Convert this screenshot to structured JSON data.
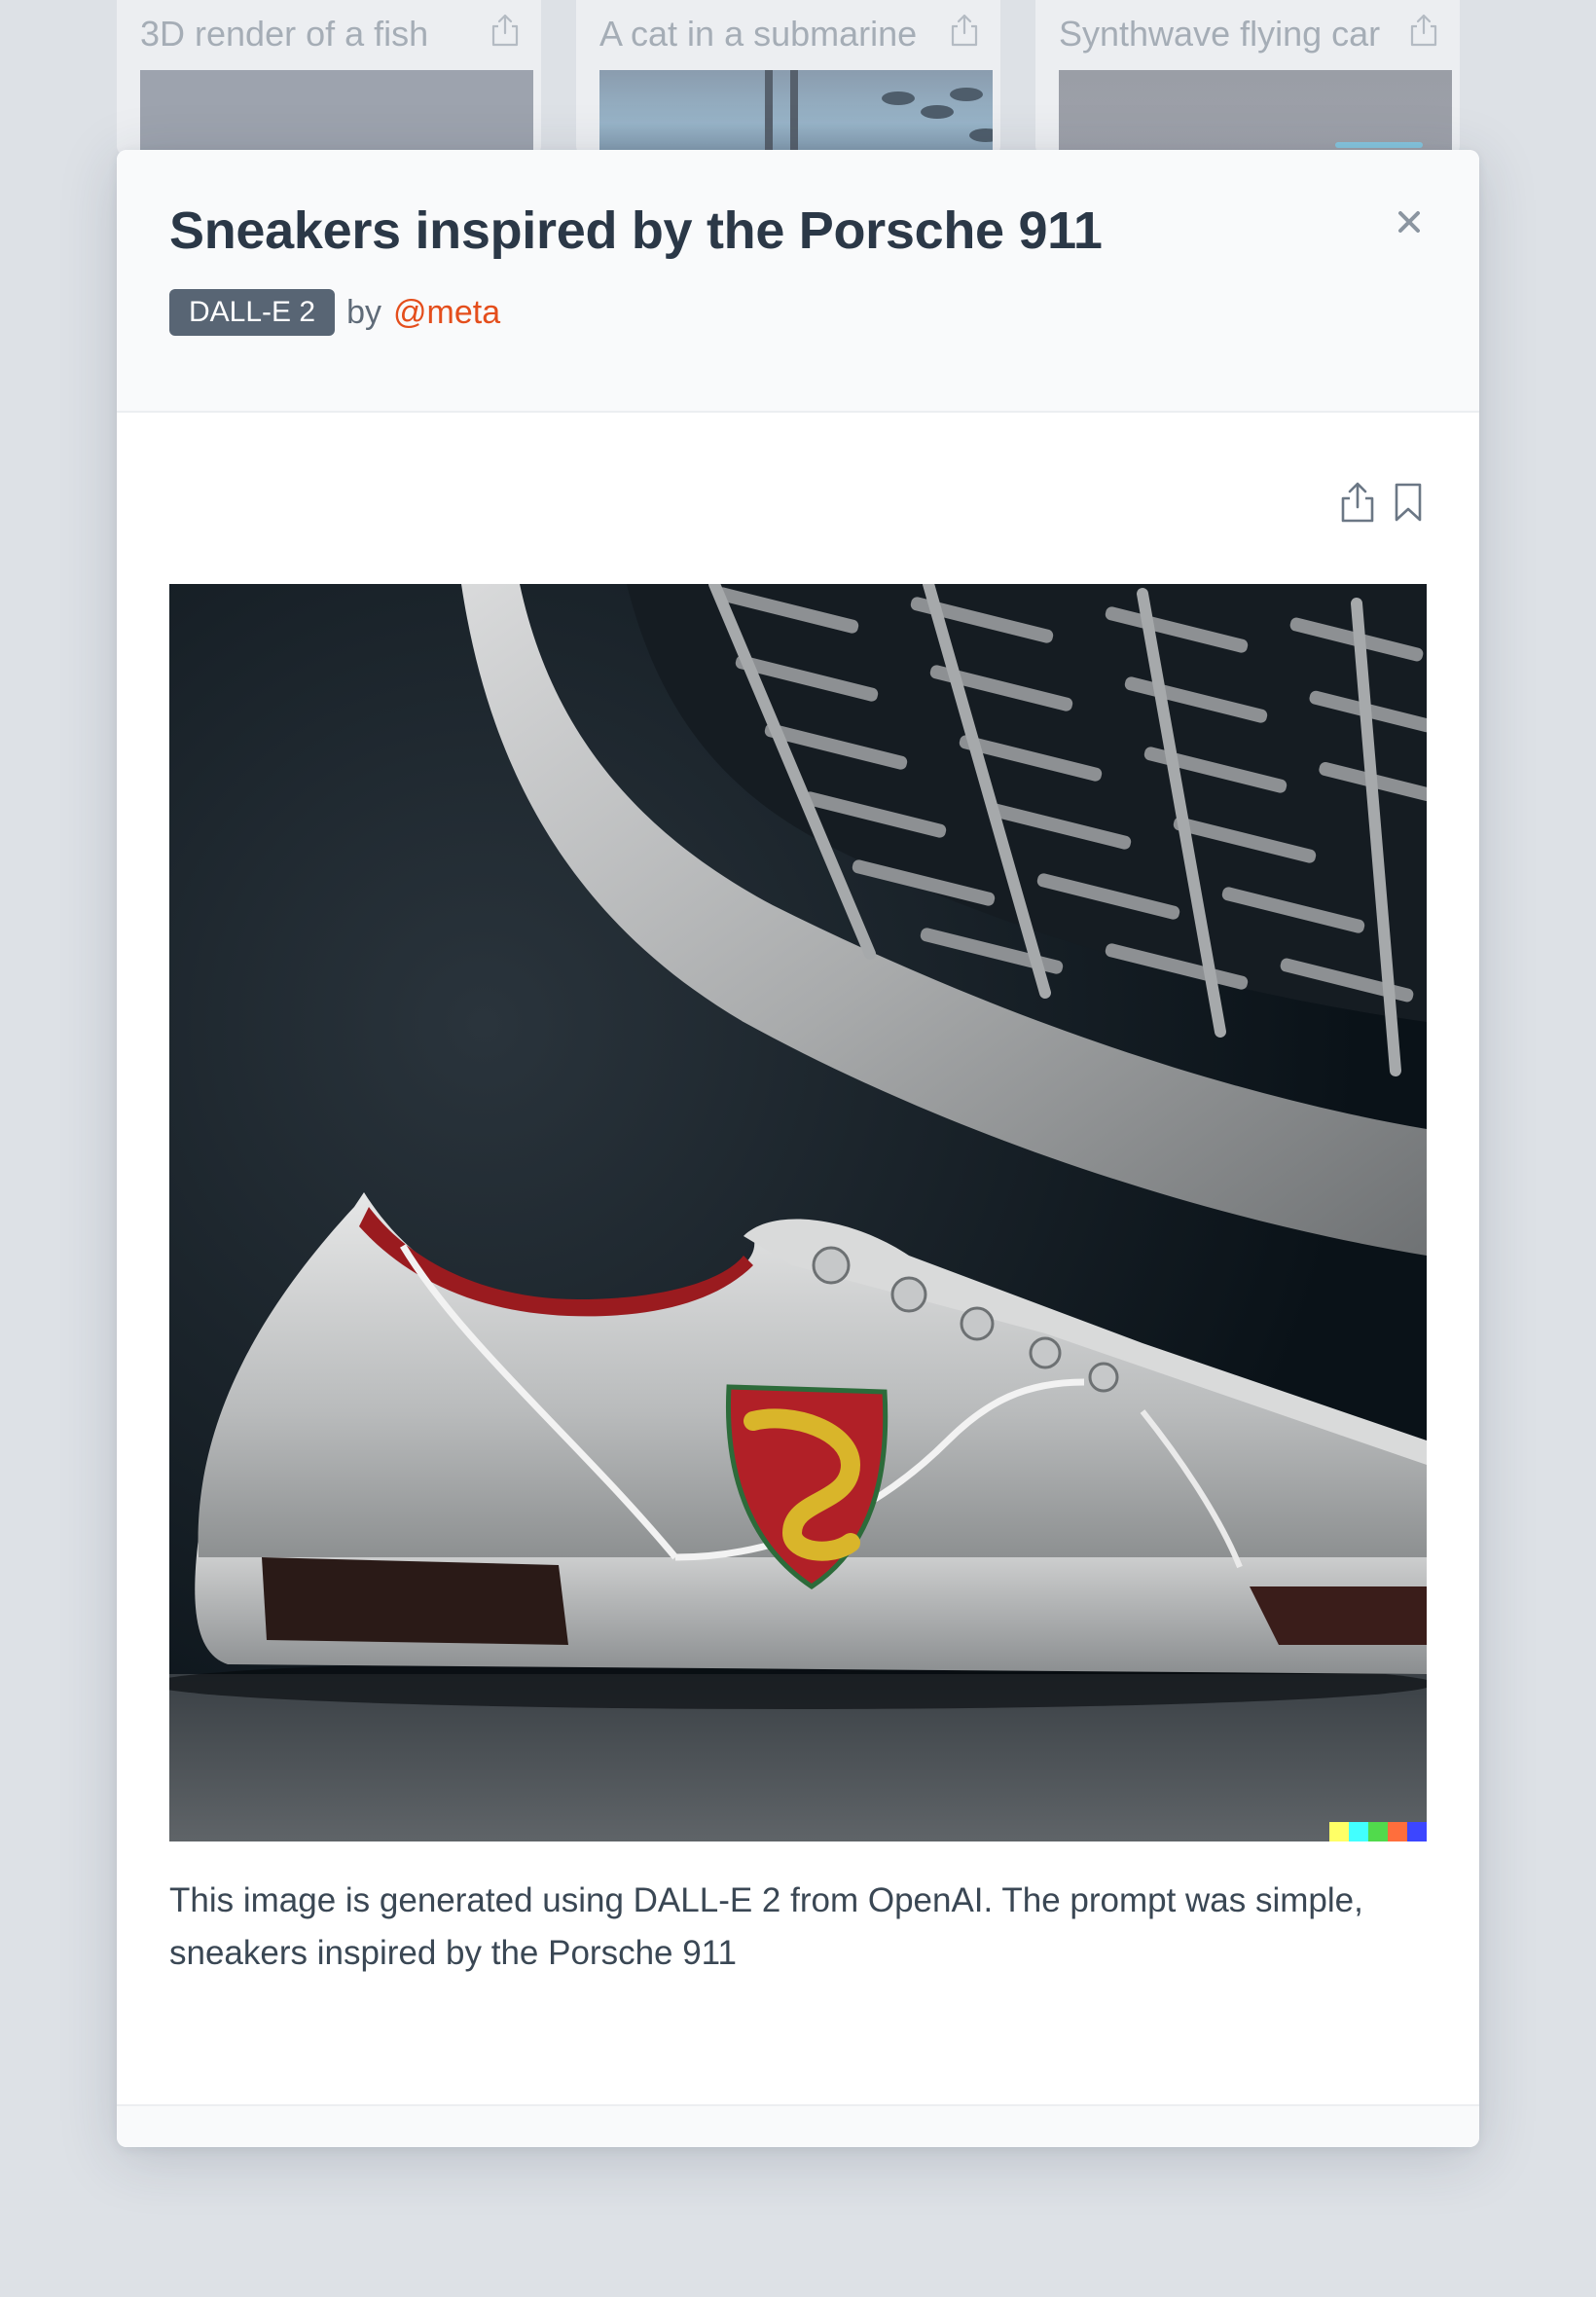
{
  "gallery": {
    "cards": [
      {
        "title": "3D render of a fish",
        "share_icon": "share-icon"
      },
      {
        "title": "A cat in a submarine",
        "share_icon": "share-icon"
      },
      {
        "title": "Synthwave flying car",
        "share_icon": "share-icon"
      }
    ]
  },
  "modal": {
    "title": "Sneakers inspired by the Porsche 911",
    "model_badge": "DALL-E 2",
    "by_label": "by",
    "author": "@meta",
    "close_icon": "close-icon",
    "actions": {
      "share_icon": "share-icon",
      "bookmark_icon": "bookmark-icon"
    },
    "image": {
      "subject": "Silver sneaker with red lining and crest emblem in front of a car grille"
    },
    "description": "This image is generated using DALL-E 2 from OpenAI. The prompt was simple, sneakers inspired by the Porsche 911"
  },
  "colors": {
    "accent_link": "#e44e1c",
    "badge_bg": "#586574",
    "title_text": "#2b3847",
    "overlay_bg": "#dde1e6"
  }
}
